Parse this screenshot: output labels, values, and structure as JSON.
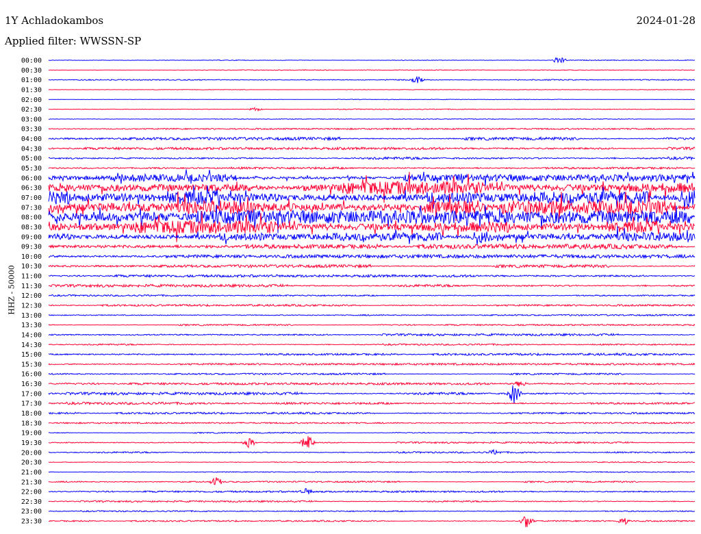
{
  "header": {
    "station": "1Y Achladokambos",
    "date": "2024-01-28",
    "filter": "Applied filter: WWSSN-SP"
  },
  "chart_data": {
    "type": "line",
    "title": "1Y Achladokambos",
    "ylabel": "HHZ - 50000",
    "tick_labels": [
      "00:00",
      "00:30",
      "01:00",
      "01:30",
      "02:00",
      "02:30",
      "03:00",
      "03:30",
      "04:00",
      "04:30",
      "05:00",
      "05:30",
      "06:00",
      "06:30",
      "07:00",
      "07:30",
      "08:00",
      "08:30",
      "09:00",
      "09:30",
      "10:00",
      "10:30",
      "11:00",
      "11:30",
      "12:00",
      "12:30",
      "13:00",
      "13:30",
      "14:00",
      "14:30",
      "15:00",
      "15:30",
      "16:00",
      "16:30",
      "17:00",
      "17:30",
      "18:00",
      "18:30",
      "19:00",
      "19:30",
      "20:00",
      "20:30",
      "21:00",
      "21:30",
      "22:00",
      "22:30",
      "23:00",
      "23:30"
    ],
    "series_colors": [
      "#0000ff",
      "#ff0033"
    ],
    "row_noise_level": [
      0.3,
      0.3,
      0.4,
      0.2,
      0.2,
      0.3,
      0.3,
      0.6,
      1.2,
      1.0,
      1.0,
      0.9,
      3,
      5,
      6,
      6,
      6,
      5,
      4,
      2,
      1.5,
      1.2,
      1,
      1,
      0.6,
      0.8,
      0.6,
      0.6,
      0.8,
      0.6,
      0.9,
      0.8,
      0.7,
      0.9,
      1.0,
      0.9,
      0.8,
      0.6,
      0.5,
      0.6,
      0.6,
      0.4,
      0.4,
      0.6,
      0.7,
      0.6,
      0.5,
      0.6
    ],
    "events": [
      {
        "row": 0,
        "x": 0.79,
        "amp": 6
      },
      {
        "row": 2,
        "x": 0.57,
        "amp": 5
      },
      {
        "row": 5,
        "x": 0.32,
        "amp": 3
      },
      {
        "row": 33,
        "x": 0.73,
        "amp": 4
      },
      {
        "row": 34,
        "x": 0.72,
        "amp": 14
      },
      {
        "row": 39,
        "x": 0.31,
        "amp": 7
      },
      {
        "row": 39,
        "x": 0.4,
        "amp": 11
      },
      {
        "row": 40,
        "x": 0.69,
        "amp": 3
      },
      {
        "row": 43,
        "x": 0.26,
        "amp": 6
      },
      {
        "row": 44,
        "x": 0.4,
        "amp": 4
      },
      {
        "row": 47,
        "x": 0.74,
        "amp": 10
      },
      {
        "row": 47,
        "x": 0.89,
        "amp": 5
      }
    ]
  }
}
